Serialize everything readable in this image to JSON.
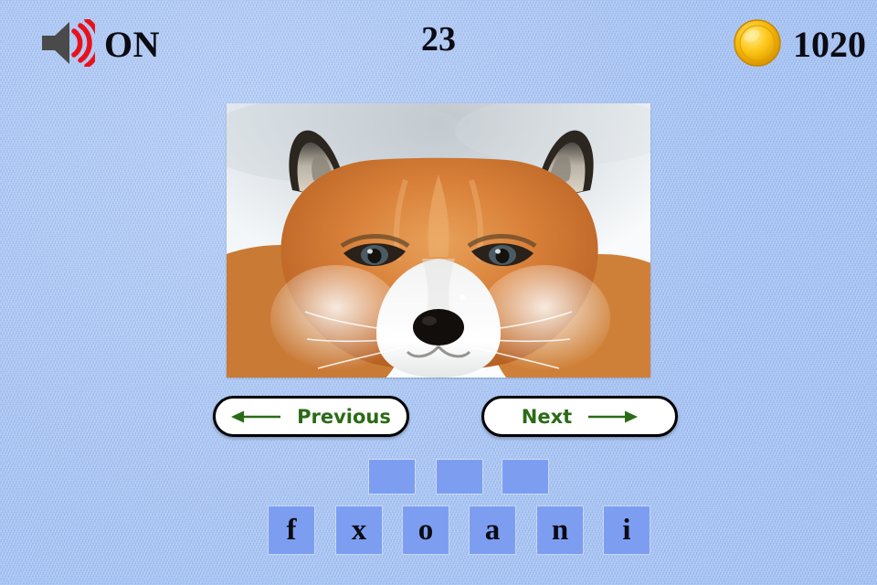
{
  "header": {
    "sound": {
      "icon": "speaker-on-icon",
      "label": "ON",
      "wave_color": "#e8121c",
      "cone_color": "#4a4a4a"
    },
    "counter": {
      "value": "23"
    },
    "score": {
      "icon": "gold-coin-icon",
      "value": "1020",
      "coin_color": "#f2b705"
    }
  },
  "picture": {
    "name": "fox-photo",
    "subject": "red fox face in snow",
    "alt": "Close-up photograph of a red fox head facing the camera against snow"
  },
  "nav": {
    "previous": {
      "label": "Previous",
      "icon": "arrow-left-icon"
    },
    "next": {
      "label": "Next",
      "icon": "arrow-right-icon"
    },
    "text_color": "#2a6b16"
  },
  "puzzle": {
    "slot_count": 3,
    "slots": [
      "",
      "",
      ""
    ],
    "letters": [
      "f",
      "x",
      "o",
      "a",
      "n",
      "i"
    ],
    "tile_color": "#7d9ef0"
  },
  "theme": {
    "background": "#a9c5f2",
    "text": "#0b0b14"
  }
}
